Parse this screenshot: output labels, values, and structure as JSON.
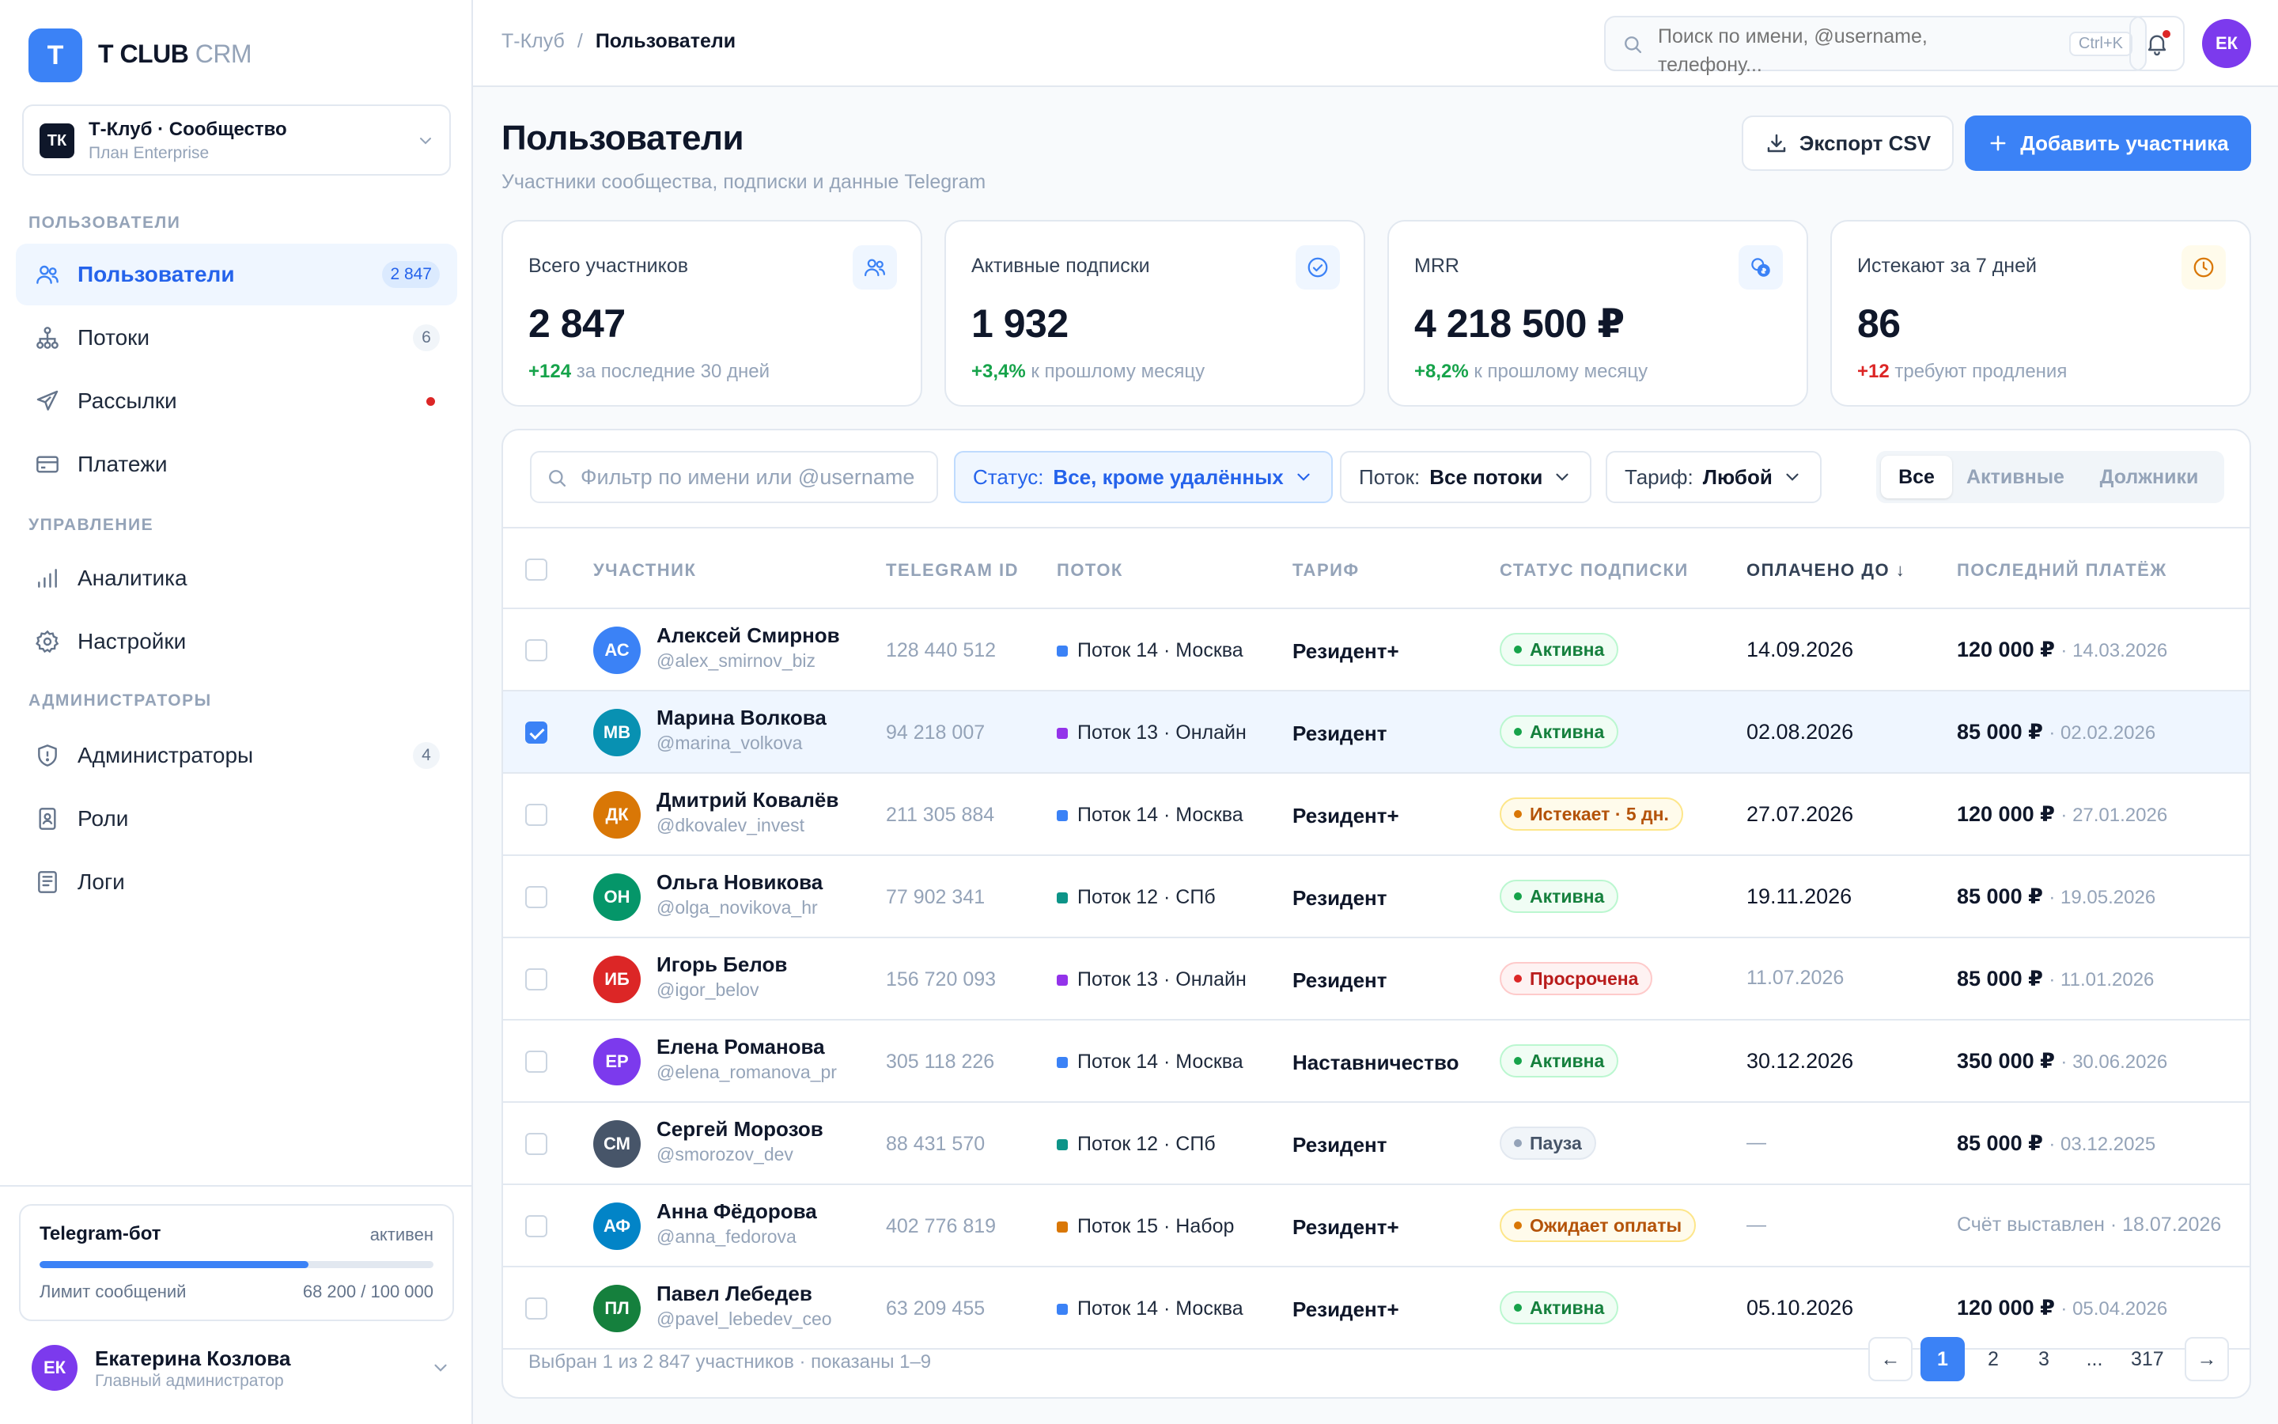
{
  "app": {
    "logo_letter": "T",
    "brand_main": "T CLUB",
    "brand_sub": "CRM"
  },
  "workspace": {
    "badge": "ТК",
    "name": "Т-Клуб · Сообщество",
    "plan": "План Enterprise"
  },
  "sidebar": {
    "section_users": "ПОЛЬЗОВАТЕЛИ",
    "section_manage": "УПРАВЛЕНИЕ",
    "section_admins": "АДМИНИСТРАТОРЫ",
    "items": [
      {
        "label": "Пользователи",
        "count": "2 847",
        "icon": "users-icon"
      },
      {
        "label": "Потоки",
        "count": "6",
        "icon": "streams-icon"
      },
      {
        "label": "Рассылки",
        "icon": "send-icon"
      },
      {
        "label": "Платежи",
        "icon": "card-icon"
      },
      {
        "label": "Аналитика",
        "icon": "chart-icon"
      },
      {
        "label": "Настройки",
        "icon": "gear-icon"
      },
      {
        "label": "Администраторы",
        "count": "4",
        "icon": "shield-icon"
      },
      {
        "label": "Роли",
        "icon": "badge-icon"
      },
      {
        "label": "Логи",
        "icon": "log-icon"
      }
    ],
    "bot": {
      "title": "Telegram-бот",
      "status": "активен",
      "limit_label": "Лимит сообщений",
      "limit_value": "68 200 / 100 000",
      "usage_fraction": 0.682
    },
    "user": {
      "initials": "ЕК",
      "name": "Екатерина Козлова",
      "role": "Главный администратор"
    }
  },
  "topbar": {
    "crumb_root": "Т-Клуб",
    "crumb_sep": "/",
    "crumb_current": "Пользователи",
    "search_placeholder": "Поиск по имени, @username, телефону...",
    "search_shortcut": "Ctrl+K",
    "avatar": "ЕК"
  },
  "page": {
    "title": "Пользователи",
    "subtitle": "Участники сообщества, подписки и данные Telegram",
    "export_label": "Экспорт CSV",
    "add_label": "Добавить участника"
  },
  "stats": [
    {
      "label": "Всего участников",
      "value": "2 847",
      "delta": "+124",
      "note": "за последние 30 дней",
      "tone": "pos",
      "icon": "users-icon"
    },
    {
      "label": "Активные подписки",
      "value": "1 932",
      "delta": "+3,4%",
      "note": "к прошлому месяцу",
      "tone": "pos",
      "icon": "check-circle-icon"
    },
    {
      "label": "MRR",
      "value": "4 218 500 ₽",
      "delta": "+8,2%",
      "note": "к прошлому месяцу",
      "tone": "pos",
      "icon": "coins-icon"
    },
    {
      "label": "Истекают за 7 дней",
      "value": "86",
      "delta": "+12",
      "note": "требуют продления",
      "tone": "neg",
      "icon": "clock-icon"
    }
  ],
  "filters": {
    "search_placeholder": "Фильтр по имени или @username",
    "status_key": "Статус:",
    "status_value": "Все, кроме удалённых",
    "stream_key": "Поток:",
    "stream_value": "Все потоки",
    "tariff_key": "Тариф:",
    "tariff_value": "Любой",
    "segments": [
      "Все",
      "Активные",
      "Должники"
    ]
  },
  "table": {
    "headers": [
      "УЧАСТНИК",
      "TELEGRAM ID",
      "ПОТОК",
      "ТАРИФ",
      "СТАТУС ПОДПИСКИ",
      "ОПЛАЧЕНО ДО ↓",
      "ПОСЛЕДНИЙ ПЛАТЁЖ"
    ],
    "rows": [
      {
        "initials": "АС",
        "avatar_color": "#3b82f6",
        "name": "Алексей Смирнов",
        "username": "@alex_smirnov_biz",
        "tg_id": "128 440 512",
        "stream": "Поток 14 · Москва",
        "stream_color": "#3b82f6",
        "tariff": "Резидент+",
        "status": "Активна",
        "status_tone": "green",
        "paid_until": "14.09.2026",
        "pay_amount": "120 000 ₽",
        "pay_date": "· 14.03.2026",
        "checked": false
      },
      {
        "initials": "МВ",
        "avatar_color": "#0891b2",
        "name": "Марина Волкова",
        "username": "@marina_volkova",
        "tg_id": "94 218 007",
        "stream": "Поток 13 · Онлайн",
        "stream_color": "#9333ea",
        "tariff": "Резидент",
        "status": "Активна",
        "status_tone": "green",
        "paid_until": "02.08.2026",
        "pay_amount": "85 000 ₽",
        "pay_date": "· 02.02.2026",
        "checked": true
      },
      {
        "initials": "ДК",
        "avatar_color": "#d97706",
        "name": "Дмитрий Ковалёв",
        "username": "@dkovalev_invest",
        "tg_id": "211 305 884",
        "stream": "Поток 14 · Москва",
        "stream_color": "#3b82f6",
        "tariff": "Резидент+",
        "status": "Истекает · 5 дн.",
        "status_tone": "amber",
        "paid_until": "27.07.2026",
        "pay_amount": "120 000 ₽",
        "pay_date": "· 27.01.2026",
        "checked": false
      },
      {
        "initials": "ОН",
        "avatar_color": "#059669",
        "name": "Ольга Новикова",
        "username": "@olga_novikova_hr",
        "tg_id": "77 902 341",
        "stream": "Поток 12 · СПб",
        "stream_color": "#0d9488",
        "tariff": "Резидент",
        "status": "Активна",
        "status_tone": "green",
        "paid_until": "19.11.2026",
        "pay_amount": "85 000 ₽",
        "pay_date": "· 19.05.2026",
        "checked": false
      },
      {
        "initials": "ИБ",
        "avatar_color": "#dc2626",
        "name": "Игорь Белов",
        "username": "@igor_belov",
        "tg_id": "156 720 093",
        "stream": "Поток 13 · Онлайн",
        "stream_color": "#9333ea",
        "tariff": "Резидент",
        "status": "Просрочена",
        "status_tone": "red",
        "paid_until": "11.07.2026",
        "paid_muted": true,
        "pay_amount": "85 000 ₽",
        "pay_date": "· 11.01.2026",
        "checked": false
      },
      {
        "initials": "ЕР",
        "avatar_color": "#7c3aed",
        "name": "Елена Романова",
        "username": "@elena_romanova_pr",
        "tg_id": "305 118 226",
        "stream": "Поток 14 · Москва",
        "stream_color": "#3b82f6",
        "tariff": "Наставничество",
        "status": "Активна",
        "status_tone": "green",
        "paid_until": "30.12.2026",
        "pay_amount": "350 000 ₽",
        "pay_date": "· 30.06.2026",
        "checked": false
      },
      {
        "initials": "СМ",
        "avatar_color": "#475569",
        "name": "Сергей Морозов",
        "username": "@smorozov_dev",
        "tg_id": "88 431 570",
        "stream": "Поток 12 · СПб",
        "stream_color": "#0d9488",
        "tariff": "Резидент",
        "status": "Пауза",
        "status_tone": "gray",
        "paid_until": "—",
        "paid_muted": true,
        "pay_amount": "85 000 ₽",
        "pay_date": "· 03.12.2025",
        "checked": false
      },
      {
        "initials": "АФ",
        "avatar_color": "#0284c7",
        "name": "Анна Фёдорова",
        "username": "@anna_fedorova",
        "tg_id": "402 776 819",
        "stream": "Поток 15 · Набор",
        "stream_color": "#d97706",
        "tariff": "Резидент+",
        "status": "Ожидает оплаты",
        "status_tone": "amber",
        "paid_until": "—",
        "paid_muted": true,
        "pay_amount": "",
        "pay_date": "",
        "pay_note": "Счёт выставлен · 18.07.2026",
        "checked": false
      },
      {
        "initials": "ПЛ",
        "avatar_color": "#15803d",
        "name": "Павел Лебедев",
        "username": "@pavel_lebedev_ceo",
        "tg_id": "63 209 455",
        "stream": "Поток 14 · Москва",
        "stream_color": "#3b82f6",
        "tariff": "Резидент+",
        "status": "Активна",
        "status_tone": "green",
        "paid_until": "05.10.2026",
        "pay_amount": "120 000 ₽",
        "pay_date": "· 05.04.2026",
        "checked": false
      }
    ],
    "footer": "Выбран 1 из 2 847 участников · показаны 1–9",
    "pagination": {
      "prev": "←",
      "pages": [
        "1",
        "2",
        "3",
        "...",
        "317"
      ],
      "current": "1",
      "next": "→"
    }
  }
}
